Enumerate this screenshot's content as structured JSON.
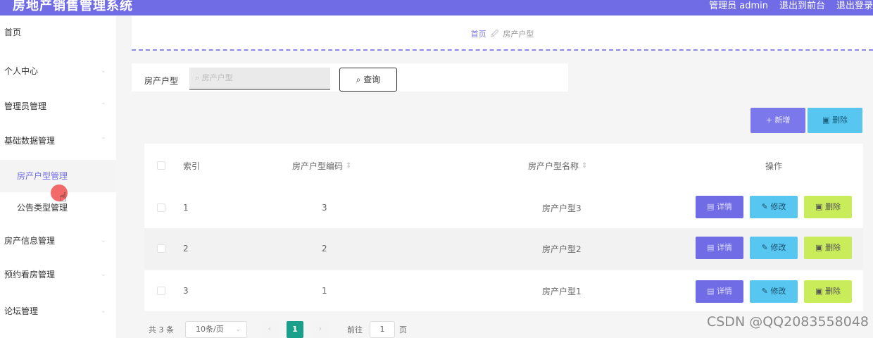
{
  "header": {
    "title": "房地产销售管理系统",
    "links": [
      "管理员 admin",
      "退出到前台",
      "退出登录"
    ]
  },
  "sidebar": {
    "items": [
      {
        "label": "首页"
      },
      {
        "label": "个人中心"
      },
      {
        "label": "管理员管理"
      },
      {
        "label": "基础数据管理"
      },
      {
        "label": "房产户型管理"
      },
      {
        "label": "公告类型管理"
      },
      {
        "label": "房产信息管理"
      },
      {
        "label": "预约看房管理"
      },
      {
        "label": "论坛管理"
      }
    ]
  },
  "breadcrumb": {
    "home": "首页",
    "current": "房产户型"
  },
  "search": {
    "label": "房产户型",
    "placeholder": "房产户型",
    "button": "查询"
  },
  "actions": {
    "add": "+ 新增",
    "delete": "删除"
  },
  "table": {
    "columns": [
      "索引",
      "房产户型编码",
      "房产户型名称",
      "操作"
    ],
    "rows": [
      {
        "index": "1",
        "code": "3",
        "name": "房产户型3"
      },
      {
        "index": "2",
        "code": "2",
        "name": "房产户型2"
      },
      {
        "index": "3",
        "code": "1",
        "name": "房产户型1"
      }
    ],
    "ops": {
      "detail": "详情",
      "edit": "修改",
      "remove": "删除"
    }
  },
  "pagination": {
    "total": "共 3 条",
    "page_size": "10条/页",
    "current_page": "1",
    "goto_label": "前往",
    "goto_value": "1",
    "page_unit": "页"
  },
  "watermark": "CSDN @QQ2083558048",
  "colors": {
    "primary": "#6f6ce6",
    "info": "#57c6f0",
    "lime": "#c9ec5a",
    "page_active": "#1aa08a"
  }
}
